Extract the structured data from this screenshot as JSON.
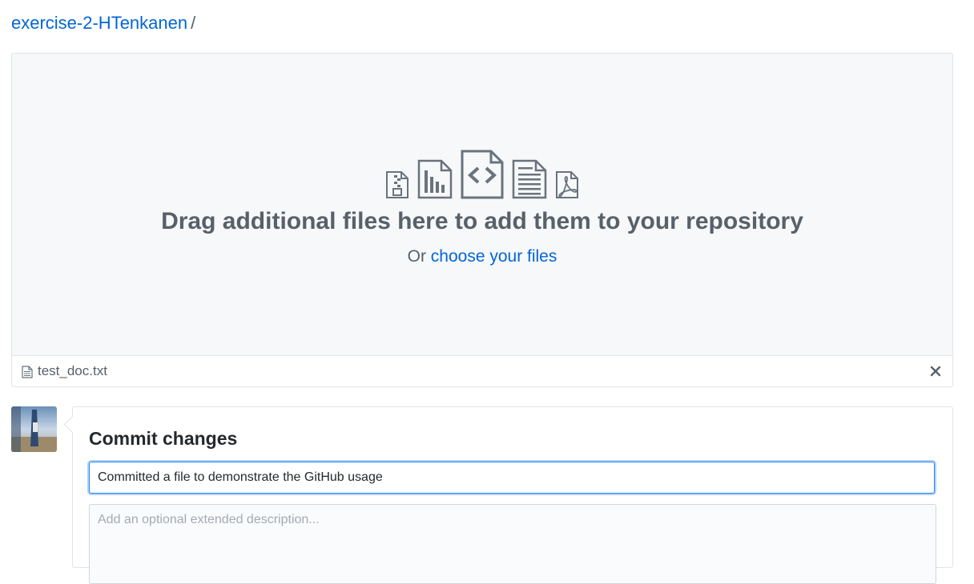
{
  "breadcrumb": {
    "repo": "exercise-2-HTenkanen",
    "separator": "/"
  },
  "dropzone": {
    "icons": [
      "file-zip-icon",
      "file-chart-icon",
      "file-code-icon",
      "file-text-icon",
      "file-pdf-icon"
    ],
    "title": "Drag additional files here to add them to your repository",
    "subtitle_prefix": "Or",
    "choose_link": "choose your files"
  },
  "uploaded_files": [
    {
      "name": "test_doc.txt"
    }
  ],
  "commit": {
    "heading": "Commit changes",
    "summary_value": "Committed a file to demonstrate the GitHub usage",
    "description_placeholder": "Add an optional extended description..."
  },
  "colors": {
    "link": "#0366d6",
    "muted": "#586069",
    "dropzone_bg": "#f6f8fa",
    "border": "#e1e4e8",
    "focus": "#2188ff"
  }
}
